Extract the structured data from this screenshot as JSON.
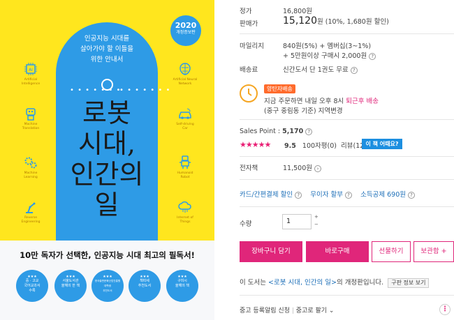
{
  "cover": {
    "badge_year": "2020",
    "badge_edition": "개정증보판",
    "subtitle": "인공지능 시대를\n살아가야 할 이들을\n위한 안내서",
    "title": "로봇\n시대,\n인간의\n일",
    "left_icons": [
      {
        "label": "Artificial\nIntelligence",
        "icon": "ai-chip-icon"
      },
      {
        "label": "Machine\nTranslation",
        "icon": "robot-icon"
      },
      {
        "label": "Machine\nLearning",
        "icon": "gears-icon"
      },
      {
        "label": "Reverse\nEngineering",
        "icon": "robot-arm-icon"
      }
    ],
    "right_icons": [
      {
        "label": "Artificial Neural\nNetwork",
        "icon": "brain-icon"
      },
      {
        "label": "Self-driving\nCar",
        "icon": "car-icon"
      },
      {
        "label": "Humanoid\nRobot",
        "icon": "humanoid-icon"
      },
      {
        "label": "Internet of\nThings",
        "icon": "cloud-icon"
      }
    ],
    "headline": "10만 독자가 선택한, 인공지능 시대 최고의 필독서!",
    "awards": [
      {
        "stars": "★★★",
        "text": "중 · 고교\n국어교과서\n수록"
      },
      {
        "stars": "★★★",
        "text": "서울도서관\n올해의 한 책"
      },
      {
        "stars": "★★★",
        "text": "한국출판문화산업진흥원\n대학생\n추천도서"
      },
      {
        "stars": "★★★",
        "text": "책따세\n추천도서"
      },
      {
        "stars": "★★★",
        "text": "구미시\n올해의 책"
      }
    ],
    "colors": {
      "yellow": "#FFE61E",
      "blue": "#2E9BE6"
    }
  },
  "info": {
    "list_price_label": "정가",
    "list_price": "16,800원",
    "sale_price_label": "판매가",
    "sale_price": "15,120",
    "sale_price_unit": "원",
    "sale_discount": "(10%, 1,680원 할인)",
    "mileage_label": "마일리지",
    "mileage_line1": "840원(5%) + 멤버십(3~1%)",
    "mileage_line2": "+ 5만원이상 구매시 2,000원",
    "shipping_label": "배송료",
    "shipping_value": "신간도서 단 1권도 무료",
    "ship_tag": "양탄자배송",
    "ship_line1_prefix": "지금 주문하면 내일 오후 8시",
    "ship_line1_highlight": "퇴근후 배송",
    "ship_line2": "(중구 중림동 기준) 지역변경",
    "sales_point_label": "Sales Point :",
    "sales_point_value": "5,170",
    "stars": "★★★★★",
    "rating": "9.5",
    "review_count": "100자평(0)",
    "review_full": "리뷰(12)",
    "ask_button": "이 책 어때요?",
    "ebook_label": "전자책",
    "ebook_price": "11,500원",
    "card_discount": "카드/간편결제 할인",
    "installment": "무이자 할부",
    "tax_deduction": "소득공제 690원",
    "qty_label": "수량",
    "qty_value": "1",
    "buttons": {
      "cart": "장바구니 담기",
      "buy": "바로구매",
      "gift": "선물하기",
      "keep": "보관함 +"
    },
    "edition_note_prefix": "이 도서는",
    "edition_note_link": "<로봇 시대, 인간의 일>",
    "edition_note_suffix": "의 개정판입니다.",
    "old_edition_button": "구판 정보 보기",
    "used_alert": "중고 등록알림 신청",
    "used_sell": "중고로 팔기",
    "accent_color": "#E0267A"
  }
}
